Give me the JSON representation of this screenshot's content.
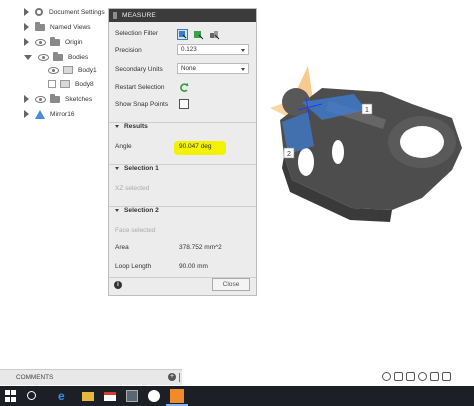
{
  "browser": {
    "items": [
      {
        "label": "Document Settings",
        "icon": "gear-icon"
      },
      {
        "label": "Named Views",
        "icon": "folder-icon"
      },
      {
        "label": "Origin",
        "icon": "folder-icon"
      },
      {
        "label": "Bodies",
        "icon": "folder-icon"
      },
      {
        "label": "Body1",
        "icon": "body-icon"
      },
      {
        "label": "Body8",
        "icon": "body-icon"
      },
      {
        "label": "Sketches",
        "icon": "folder-icon"
      },
      {
        "label": "Mirror16",
        "icon": "mirror-icon"
      }
    ]
  },
  "measure": {
    "title": "MEASURE",
    "selection_filter_label": "Selection Filter",
    "precision_label": "Precision",
    "precision_value": "0.123",
    "secondary_units_label": "Secondary Units",
    "secondary_units_value": "None",
    "restart_selection_label": "Restart Selection",
    "show_snap_points_label": "Show Snap Points",
    "results_title": "Results",
    "angle_label": "Angle",
    "angle_value": "90.047 deg",
    "selection1_title": "Selection 1",
    "selection1_value": "XZ selected",
    "selection2_title": "Selection 2",
    "selection2_value": "Face selected",
    "area_label": "Area",
    "area_value": "378.752 mm^2",
    "loop_length_label": "Loop Length",
    "loop_length_value": "90.00 mm",
    "close_label": "Close"
  },
  "viewport": {
    "marker1": "1",
    "marker2": "2",
    "colors": {
      "plane_orange": "#f5a742",
      "plane_blue": "#3d7fd9",
      "part": "#4d4d4d"
    }
  },
  "comments": {
    "label": "COMMENTS"
  },
  "taskbar": {
    "icons": [
      "windows-icon",
      "search-icon",
      "edge-icon",
      "file-explorer-icon",
      "gmail-icon",
      "calculator-icon",
      "paint-icon",
      "fusion-icon"
    ]
  }
}
